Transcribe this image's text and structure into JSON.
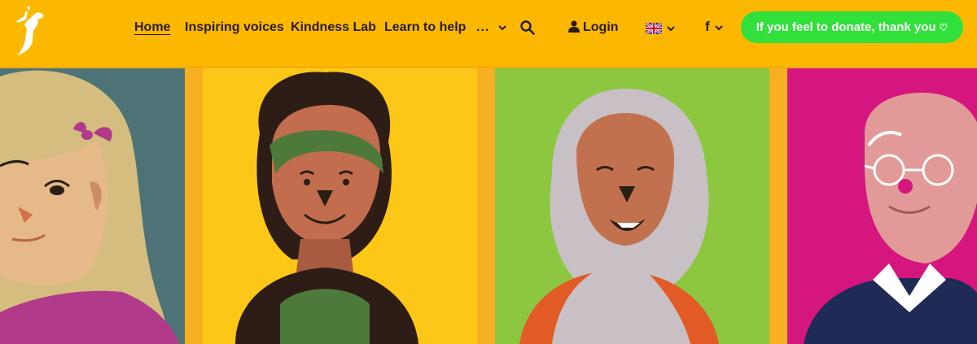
{
  "header": {
    "logo_icon": "dancing-figure-logo",
    "nav": {
      "home": "Home",
      "inspiring_voices": "Inspiring voices",
      "kindness_lab": "Kindness Lab",
      "learn_to_help": "Learn to help",
      "more": "..."
    },
    "search_icon": "search-icon",
    "login_label": "Login",
    "language_icon": "uk-flag-icon",
    "facebook_label": "f",
    "donate_label": "If you feel to donate, thank you",
    "donate_heart": "♡"
  },
  "hero": {
    "panels": [
      {
        "color": "#4e7376",
        "icon": "girl-with-bow-illustration"
      },
      {
        "color": "#fcc716",
        "icon": "woman-with-headband-illustration"
      },
      {
        "color": "#8dc63f",
        "icon": "woman-in-hijab-illustration"
      },
      {
        "color": "#d5167f",
        "icon": "old-man-with-glasses-illustration"
      }
    ]
  },
  "colors": {
    "header_bg": "#fcb800",
    "donate_bg": "#31e03a",
    "text_dark": "#2a1d12"
  }
}
